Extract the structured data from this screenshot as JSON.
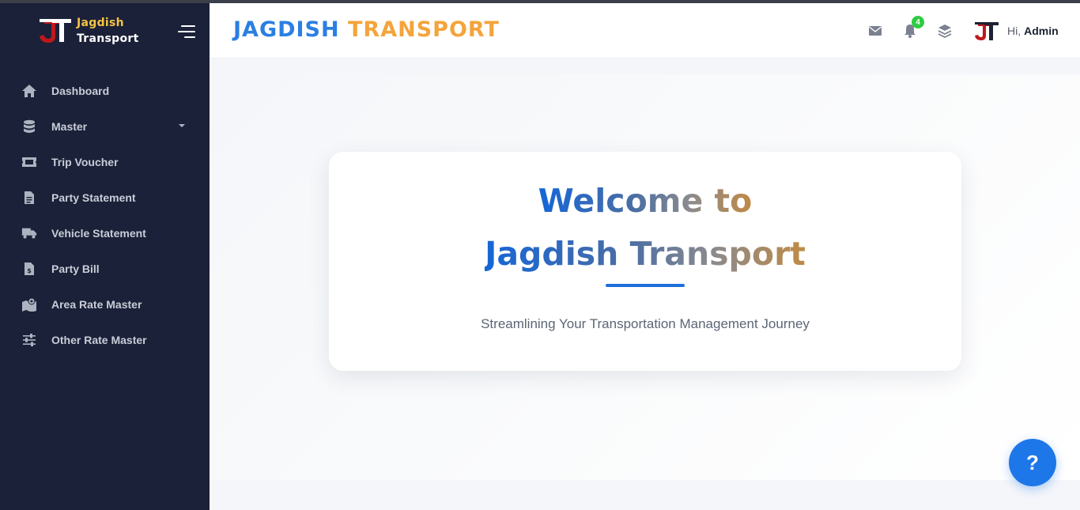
{
  "brand": {
    "line1": "Jagdish",
    "line2": "Transport"
  },
  "sidebar": {
    "items": [
      {
        "label": "Dashboard",
        "icon": "home-icon"
      },
      {
        "label": "Master",
        "icon": "database-icon"
      },
      {
        "label": "Trip Voucher",
        "icon": "ticket-icon"
      },
      {
        "label": "Party Statement",
        "icon": "document-icon"
      },
      {
        "label": "Vehicle Statement",
        "icon": "truck-icon"
      },
      {
        "label": "Party Bill",
        "icon": "invoice-icon"
      },
      {
        "label": "Area Rate Master",
        "icon": "map-icon"
      },
      {
        "label": "Other Rate Master",
        "icon": "sliders-icon"
      }
    ]
  },
  "header": {
    "title_part1": "JAGDISH",
    "title_part2": "TRANSPORT",
    "notification_count": "4",
    "greeting": "Hi,",
    "username": "Admin"
  },
  "welcome": {
    "line1": "Welcome to",
    "line2": "Jagdish Transport",
    "tagline": "Streamlining Your Transportation Management Journey"
  },
  "help": {
    "label": "?"
  },
  "colors": {
    "sidebar_bg": "#1b2138",
    "brand_yellow": "#f6c343",
    "title_blue": "#2b7fe3",
    "title_orange": "#f4a43b",
    "badge_green": "#2ecc40",
    "help_blue": "#1e77e8"
  }
}
